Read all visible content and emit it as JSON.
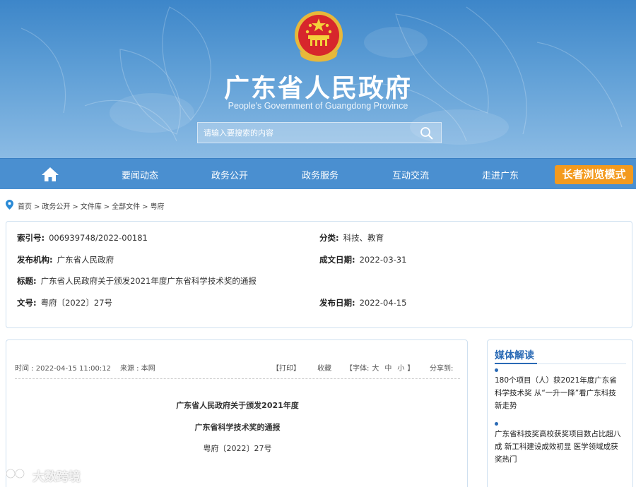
{
  "header": {
    "site_title": "广东省人民政府",
    "site_subtitle": "People's Government of Guangdong Province",
    "search_placeholder": "请输入要搜索的内容"
  },
  "nav": {
    "items": [
      "要闻动态",
      "政务公开",
      "政务服务",
      "互动交流",
      "走进广东"
    ],
    "elder_mode": "长者浏览模式"
  },
  "breadcrumb": [
    "首页",
    "政务公开",
    "文件库",
    "全部文件",
    "粤府"
  ],
  "meta": {
    "index_no_label": "索引号:",
    "index_no": "006939748/2022-00181",
    "category_label": "分类:",
    "category": "科技、教育",
    "issuer_label": "发布机构:",
    "issuer": "广东省人民政府",
    "doc_date_label": "成文日期:",
    "doc_date": "2022-03-31",
    "title_label": "标题:",
    "title": "广东省人民政府关于颁发2021年度广东省科学技术奖的通报",
    "doc_no_label": "文号:",
    "doc_no": "粤府〔2022〕27号",
    "pub_date_label": "发布日期:",
    "pub_date": "2022-04-15"
  },
  "article": {
    "time": "时间 : 2022-04-15 11:00:12",
    "source": "来源 : 本网",
    "print": "【打印】",
    "favorite": "收藏",
    "font_label": "【字体:",
    "font_large": "大",
    "font_medium": "中",
    "font_small": "小",
    "font_close": "】",
    "share": "分享到:",
    "title_line1": "广东省人民政府关于颁发2021年度",
    "title_line2": "广东省科学技术奖的通报",
    "doc_no": "粤府〔2022〕27号"
  },
  "side": {
    "title": "媒体解读",
    "items": [
      "180个项目（人）获2021年度广东省科学技术奖 从“一升一降”看广东科技新走势",
      "广东省科技奖高校获奖项目数占比超八成 新工科建设成效初显 医学领域成获奖热门"
    ]
  },
  "watermark": {
    "text": "大数跨境"
  },
  "colors": {
    "banner": "#4a8fd0",
    "elder_button": "#f39a1e",
    "accent_blue": "#2a6ab5",
    "panel_border": "#cfe0f0"
  }
}
